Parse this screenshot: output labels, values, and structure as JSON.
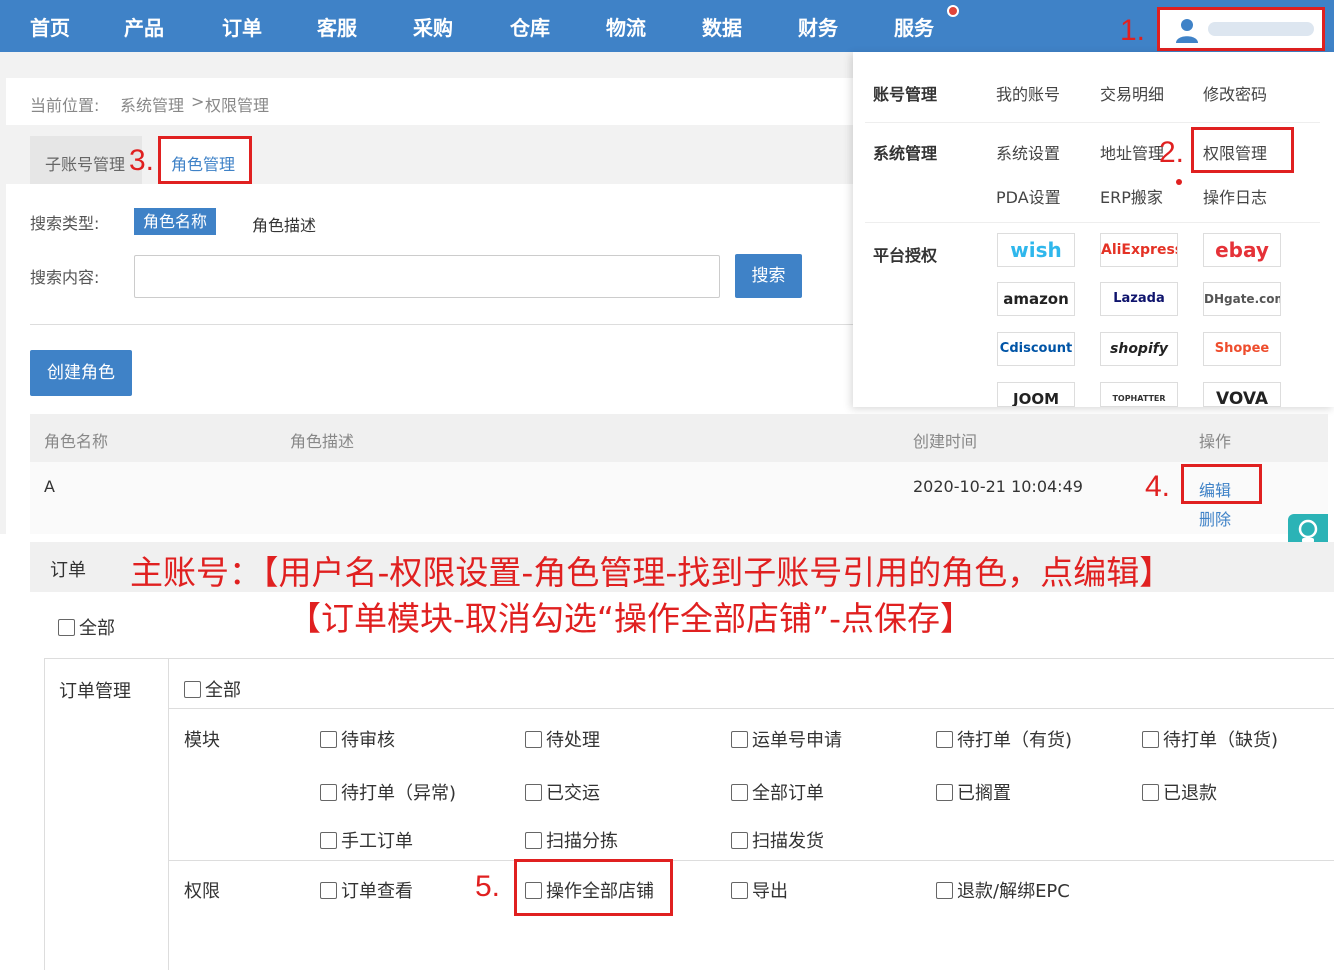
{
  "nav": {
    "items": [
      "首页",
      "产品",
      "订单",
      "客服",
      "采购",
      "仓库",
      "物流",
      "数据",
      "财务",
      "服务"
    ]
  },
  "steps": {
    "s1": "1.",
    "s2": "2.",
    "s3": "3.",
    "s4": "4.",
    "s5": "5."
  },
  "breadcrumb": {
    "prefix": "当前位置:",
    "path1": "系统管理",
    "sep": ">",
    "path2": "权限管理"
  },
  "tabs": {
    "sub_account": "子账号管理",
    "role": "角色管理"
  },
  "search": {
    "type_label": "搜索类型:",
    "type_active": "角色名称",
    "type_other": "角色描述",
    "content_label": "搜索内容:",
    "input_value": "",
    "button": "搜索"
  },
  "create_role_button": "创建角色",
  "dropdown": {
    "account": {
      "head": "账号管理",
      "my_account": "我的账号",
      "transactions": "交易明细",
      "change_password": "修改密码"
    },
    "system": {
      "head": "系统管理",
      "settings": "系统设置",
      "address": "地址管理",
      "permission": "权限管理",
      "pda": "PDA设置",
      "erp": "ERP搬家",
      "log": "操作日志"
    },
    "platform": {
      "head": "平台授权",
      "logos": [
        "wish",
        "AliExpress",
        "ebay",
        "amazon",
        "Lazada",
        "DHgate.com",
        "Cdiscount",
        "shopify",
        "Shopee",
        "JOOM",
        "TOPHATTER",
        "VOVA"
      ]
    }
  },
  "table": {
    "headers": {
      "name": "角色名称",
      "desc": "角色描述",
      "created": "创建时间",
      "ops": "操作"
    },
    "row": {
      "name": "A",
      "created": "2020-10-21 10:04:49",
      "edit": "编辑",
      "delete": "删除"
    }
  },
  "order_section": {
    "title": "订单",
    "all": "全部",
    "caption_line1": "主账号：【用户名-权限设置-角色管理-找到子账号引用的角色，点编辑】",
    "caption_line2": "【订单模块-取消勾选“操作全部店铺”-点保存】",
    "order_mgmt": "订单管理",
    "mgmt_all": "全部",
    "module_label": "模块",
    "modules": [
      "待审核",
      "待处理",
      "运单号申请",
      "待打单（有货)",
      "待打单（缺货)",
      "待打单（异常)",
      "已交运",
      "全部订单",
      "已搁置",
      "已退款",
      "手工订单",
      "扫描分拣",
      "扫描发货"
    ],
    "permission_label": "权限",
    "permissions": [
      "订单查看",
      "操作全部店铺",
      "导出",
      "退款/解绑EPC"
    ]
  },
  "colors": {
    "brand": "#3f82c7",
    "annotation": "#e02020",
    "help": "#2bb3b6"
  },
  "icons": {
    "user": "user-icon",
    "help": "customer-service-icon"
  }
}
